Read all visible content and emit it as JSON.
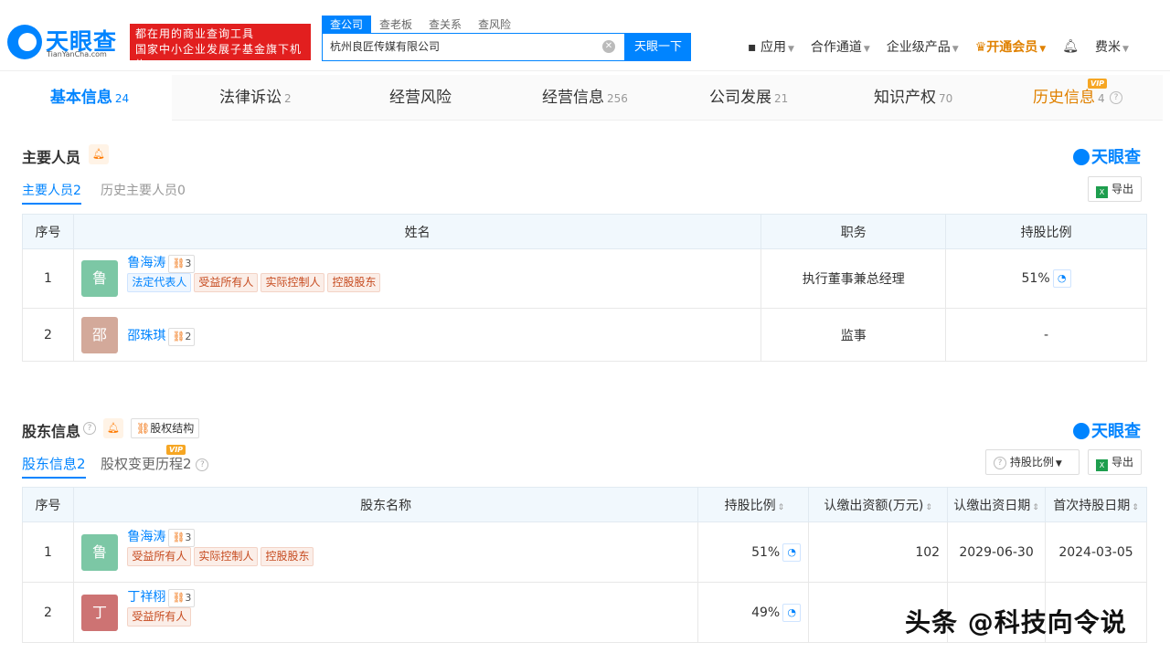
{
  "header": {
    "logo_text": "天眼查",
    "logo_sub": "TianYanCha.com",
    "slogan_line1": "都在用的商业查询工具",
    "slogan_line2": "国家中小企业发展子基金旗下机构",
    "search_tabs": [
      "查公司",
      "查老板",
      "查关系",
      "查风险"
    ],
    "search_value": "杭州良匠传媒有限公司",
    "search_button": "天眼一下",
    "nav": {
      "app": "应用",
      "partner": "合作通道",
      "enterprise": "企业级产品",
      "vip": "开通会员",
      "user": "费米"
    }
  },
  "tabs": [
    {
      "label": "基本信息",
      "count": "24"
    },
    {
      "label": "法律诉讼",
      "count": "2"
    },
    {
      "label": "经营风险",
      "count": ""
    },
    {
      "label": "经营信息",
      "count": "256"
    },
    {
      "label": "公司发展",
      "count": "21"
    },
    {
      "label": "知识产权",
      "count": "70"
    },
    {
      "label": "历史信息",
      "count": "4"
    }
  ],
  "vip_badge": "VIP",
  "personnel": {
    "title": "主要人员",
    "brand": "天眼查",
    "subtab_current_label": "主要人员",
    "subtab_current_count": "2",
    "subtab_history_label": "历史主要人员",
    "subtab_history_count": "0",
    "export": "导出",
    "headers": [
      "序号",
      "姓名",
      "职务",
      "持股比例"
    ],
    "rows": [
      {
        "no": "1",
        "avatar": "鲁",
        "avatar_color": "#7cc7a5",
        "name": "鲁海涛",
        "rel": "3",
        "tags": [
          "法定代表人",
          "受益所有人",
          "实际控制人",
          "控股股东"
        ],
        "position": "执行董事兼总经理",
        "share": "51%"
      },
      {
        "no": "2",
        "avatar": "邵",
        "avatar_color": "#d3a99a",
        "name": "邵珠琪",
        "rel": "2",
        "tags": [],
        "position": "监事",
        "share": "-"
      }
    ]
  },
  "shareholders": {
    "title": "股东信息",
    "structure_btn": "股权结构",
    "brand": "天眼查",
    "subtab_current_label": "股东信息",
    "subtab_current_count": "2",
    "subtab_change_label": "股权变更历程",
    "subtab_change_count": "2",
    "filter_btn": "持股比例",
    "export": "导出",
    "headers": [
      "序号",
      "股东名称",
      "持股比例",
      "认缴出资额(万元)",
      "认缴出资日期",
      "首次持股日期"
    ],
    "rows": [
      {
        "no": "1",
        "avatar": "鲁",
        "avatar_color": "#7cc7a5",
        "name": "鲁海涛",
        "rel": "3",
        "tags": [
          "受益所有人",
          "实际控制人",
          "控股股东"
        ],
        "share": "51%",
        "capital": "102",
        "sub_date": "2029-06-30",
        "first_date": "2024-03-05"
      },
      {
        "no": "2",
        "avatar": "丁",
        "avatar_color": "#cd7373",
        "name": "丁祥栩",
        "rel": "3",
        "tags": [
          "受益所有人"
        ],
        "share": "49%",
        "capital": "",
        "sub_date": "",
        "first_date": ""
      }
    ]
  },
  "watermark": "头条 @科技向令说"
}
